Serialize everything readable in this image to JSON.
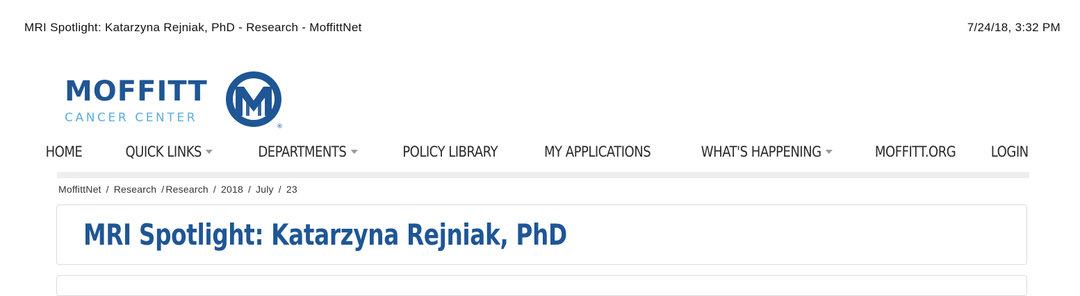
{
  "print_header": {
    "title": "MRI Spotlight: Katarzyna Rejniak, PhD - Research - MoffittNet",
    "datetime": "7/24/18, 3:32 PM"
  },
  "logo": {
    "word": "MOFFITT",
    "subtitle": "CANCER CENTER",
    "registered": "®",
    "icon": "moffitt-m-logo-icon",
    "brand_color": "#1f5695",
    "accent_color": "#5aaedc"
  },
  "nav": {
    "items": [
      {
        "label": "HOME",
        "dropdown": false
      },
      {
        "label": "QUICK LINKS",
        "dropdown": true
      },
      {
        "label": "DEPARTMENTS",
        "dropdown": true
      },
      {
        "label": "POLICY LIBRARY",
        "dropdown": false
      },
      {
        "label": "MY APPLICATIONS",
        "dropdown": false
      },
      {
        "label": "WHAT'S HAPPENING",
        "dropdown": true
      },
      {
        "label": "MOFFITT.ORG",
        "dropdown": false
      },
      {
        "label": "LOGIN",
        "dropdown": false
      }
    ],
    "caret_icon": "caret-down-icon"
  },
  "breadcrumb": {
    "items": [
      "MoffittNet",
      "Research",
      "Research",
      "2018",
      "July",
      "23"
    ],
    "separator": "/"
  },
  "page": {
    "title": "MRI Spotlight: Katarzyna Rejniak, PhD"
  }
}
